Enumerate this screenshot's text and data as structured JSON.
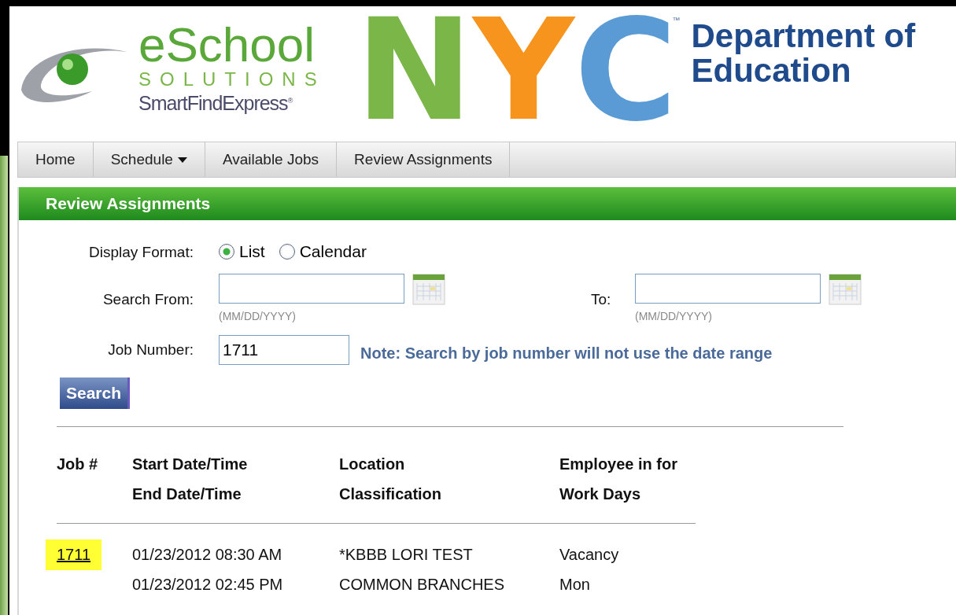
{
  "logo": {
    "brand": "eSchool",
    "tagline": "SOLUTIONS",
    "product": "SmartFindExpress",
    "mark": "®"
  },
  "nyc_logo": {
    "letters": [
      {
        "text": "N",
        "color": "#7ab648"
      },
      {
        "text": "Y",
        "color": "#f7941d"
      },
      {
        "text": "C",
        "color": "#5b9bd5"
      }
    ],
    "trademark": "™"
  },
  "department": [
    "Department of",
    "Education"
  ],
  "nav": [
    {
      "label": "Home",
      "dropdown": false
    },
    {
      "label": "Schedule",
      "dropdown": true
    },
    {
      "label": "Available Jobs",
      "dropdown": false
    },
    {
      "label": "Review Assignments",
      "dropdown": false
    }
  ],
  "panel": {
    "title": "Review Assignments"
  },
  "form": {
    "display_format": {
      "label": "Display Format:",
      "options": [
        {
          "label": "List",
          "selected": true
        },
        {
          "label": "Calendar",
          "selected": false
        }
      ]
    },
    "search_from": {
      "label": "Search From:",
      "format_hint": "(MM/DD/YYYY)"
    },
    "to": {
      "label": "To:",
      "format_hint": "(MM/DD/YYYY)"
    },
    "job_number": {
      "label": "Job Number:",
      "value": "1711"
    },
    "note": "Note: Search by job number will not use the date range",
    "search_button": "Search"
  },
  "table": {
    "header_rows": [
      [
        "Job #",
        "Start Date/Time",
        "Location",
        "Employee in for"
      ],
      [
        null,
        "End Date/Time",
        "Classification",
        "Work Days"
      ]
    ],
    "rows": [
      [
        {
          "text": "1711",
          "highlighted": true
        },
        "01/23/2012 08:30 AM",
        "*KBBB LORI TEST",
        "Vacancy"
      ],
      [
        null,
        "01/23/2012 02:45 PM",
        "COMMON BRANCHES",
        "Mon"
      ]
    ]
  }
}
